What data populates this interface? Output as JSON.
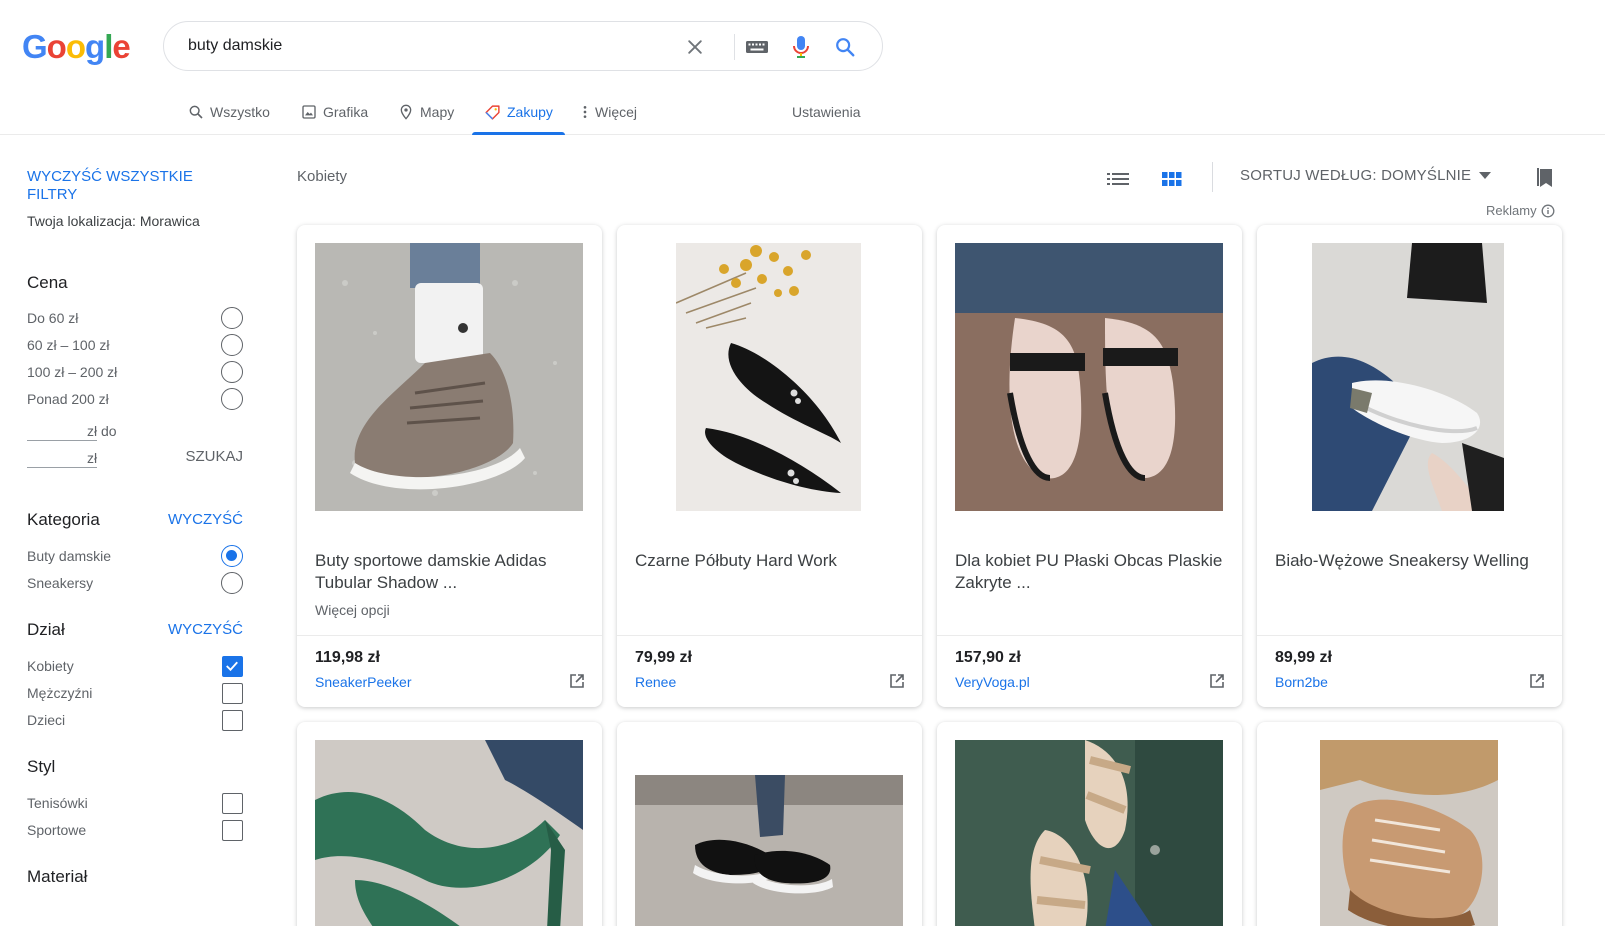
{
  "logo": {
    "letters": [
      "G",
      "o",
      "o",
      "g",
      "l",
      "e"
    ],
    "colors": [
      "#4285f4",
      "#ea4335",
      "#fbbc05",
      "#4285f4",
      "#34a853",
      "#ea4335"
    ]
  },
  "search": {
    "query": "buty damskie"
  },
  "tabs": [
    {
      "label": "Wszystko",
      "icon": "search-icon"
    },
    {
      "label": "Grafika",
      "icon": "image-icon"
    },
    {
      "label": "Mapy",
      "icon": "map-pin-icon"
    },
    {
      "label": "Zakupy",
      "icon": "tag-icon",
      "active": true
    },
    {
      "label": "Więcej",
      "icon": "more-vert-icon"
    }
  ],
  "settings_label": "Ustawienia",
  "sidebar": {
    "clear_all": "WYCZYŚĆ WSZYSTKIE FILTRY",
    "location": "Twoja lokalizacja: Morawica",
    "price": {
      "title": "Cena",
      "options": [
        "Do 60 zł",
        "60 zł – 100 zł",
        "100 zł – 200 zł",
        "Ponad 200 zł"
      ],
      "from_suffix": "zł do",
      "to_suffix": "zł",
      "search_label": "SZUKAJ"
    },
    "category": {
      "title": "Kategoria",
      "clear": "WYCZYŚĆ",
      "options": [
        {
          "label": "Buty damskie",
          "checked": true
        },
        {
          "label": "Sneakersy",
          "checked": false
        }
      ]
    },
    "department": {
      "title": "Dział",
      "clear": "WYCZYŚĆ",
      "options": [
        {
          "label": "Kobiety",
          "checked": true
        },
        {
          "label": "Mężczyźni",
          "checked": false
        },
        {
          "label": "Dzieci",
          "checked": false
        }
      ]
    },
    "style": {
      "title": "Styl",
      "options": [
        {
          "label": "Tenisówki",
          "checked": false
        },
        {
          "label": "Sportowe",
          "checked": false
        }
      ]
    },
    "material": {
      "title": "Materiał"
    }
  },
  "results": {
    "crumb": "Kobiety",
    "sort_label": "SORTUJ WEDŁUG: DOMYŚLNIE",
    "ads_label": "Reklamy"
  },
  "products": [
    {
      "title": "Buty sportowe damskie Adidas Tubular Shadow ...",
      "subtitle": "Więcej opcji",
      "price": "119,98 zł",
      "store": "SneakerPeeker",
      "image": "taupe-sneaker-photo"
    },
    {
      "title": "Czarne Półbuty Hard Work",
      "subtitle": "",
      "price": "79,99 zł",
      "store": "Renee",
      "image": "black-flats-photo"
    },
    {
      "title": "Dla kobiet PU Płaski Obcas Plaskie Zakryte ...",
      "subtitle": "",
      "price": "157,90 zł",
      "store": "VeryVoga.pl",
      "image": "pink-flats-photo"
    },
    {
      "title": "Biało-Wężowe Sneakersy Welling",
      "subtitle": "",
      "price": "89,99 zł",
      "store": "Born2be",
      "image": "white-sneaker-photo"
    },
    {
      "image": "green-heels-photo"
    },
    {
      "image": "black-runner-photo"
    },
    {
      "image": "beige-sandals-photo"
    },
    {
      "image": "chunky-sneaker-photo"
    }
  ]
}
